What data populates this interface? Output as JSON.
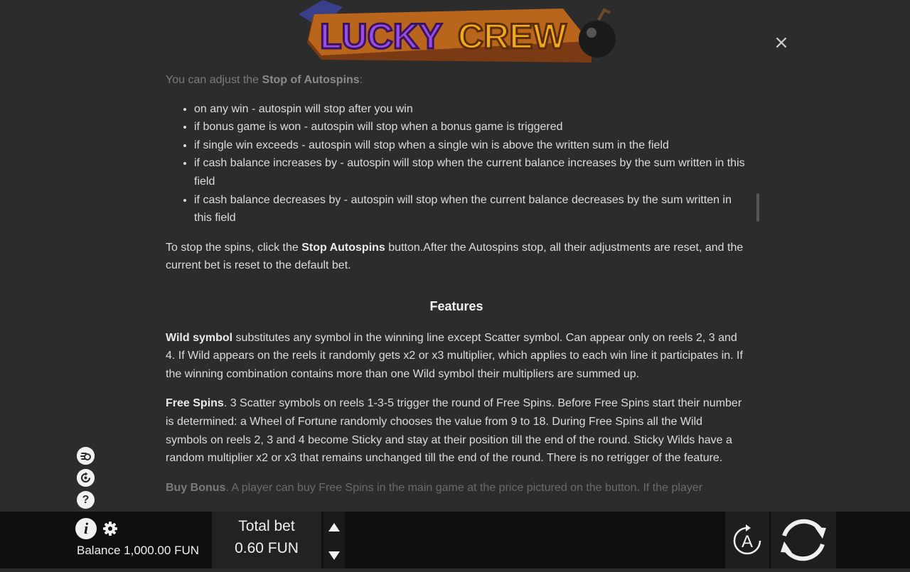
{
  "logo": {
    "text_left": "LUCKY",
    "text_right": "CREW"
  },
  "close_icon": "×",
  "rules": {
    "autospin_intro": {
      "prefix": "You can adjust the ",
      "bold": "Stop of Autospins",
      "suffix": ":"
    },
    "stop_options": [
      "on any win - autospin will stop after you win",
      "if bonus game is won - autospin will stop when a bonus game is triggered",
      "if single win exceeds - autospin will stop when a single win is above the written sum in the field",
      "if cash balance increases by - autospin will stop when the current balance increases by the sum written in this field",
      "if cash balance decreases by - autospin will stop when the current balance decreases by the sum written in this field"
    ],
    "stop_spins": {
      "prefix": "To stop the spins, click the ",
      "bold": "Stop Autospins",
      "suffix": " button.After the Autospins stop, all their adjustments are reset, and the current bet is reset to the default bet."
    },
    "features_title": "Features",
    "wild": {
      "bold": "Wild symbol",
      "text": " substitutes any symbol in the winning line except Scatter symbol. Can appear only on reels 2, 3 and 4. If Wild appears on the reels it randomly gets x2 or x3 multiplier, which applies to each win line it participates in. If the winning combination contains more than one Wild symbol their multipliers are summed up."
    },
    "free_spins": {
      "bold": "Free Spins",
      "text": ". 3 Scatter symbols on reels 1-3-5 trigger the round of Free Spins. Before Free Spins start their number is determined: a Wheel of Fortune randomly chooses the value from 9 to 18. During Free Spins all the Wild symbols on reels 2, 3 and 4 become Sticky and stay at their position till the end of the round. Sticky Wilds have a random multiplier x2 or x3 that remains unchanged till the end of the round. There is no retrigger of the feature."
    },
    "buy_bonus": {
      "bold": "Buy Bonus",
      "text": ". A player can buy Free Spins in the main game at the price pictured on the button. If the player"
    }
  },
  "side_icons": {
    "turbo": "turbo-spin-icon",
    "autoplay": "autoplay-icon",
    "help": "?"
  },
  "bottom_bar": {
    "info": "i",
    "balance_label": "Balance",
    "balance_value": "1,000.00 FUN",
    "total_bet_label": "Total bet",
    "total_bet_value": "0.60 FUN",
    "auto_label": "A"
  },
  "colors": {
    "background": "#2c2c2c",
    "bottom_bar": "#0f0f0f",
    "text": "#dcdcdc",
    "logo_purple": "#8a3fd6",
    "logo_orange": "#f0a11c"
  }
}
